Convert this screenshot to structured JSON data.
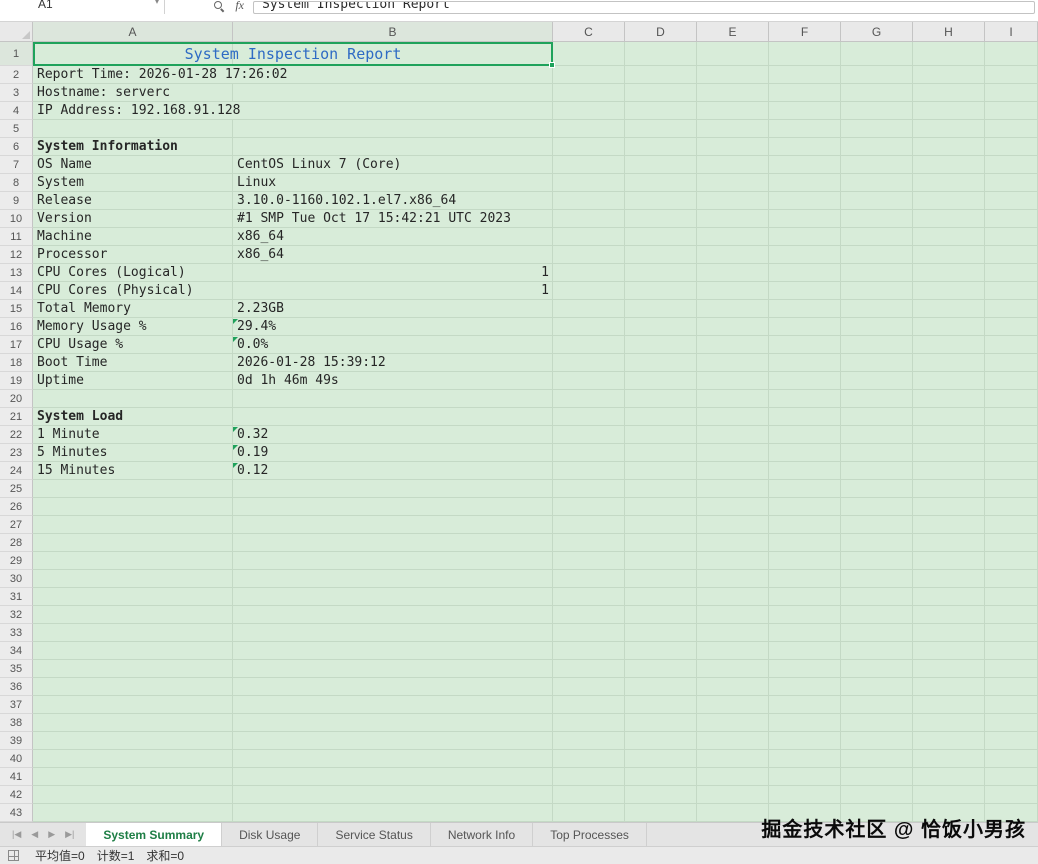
{
  "formula_bar": {
    "cell_ref": "A1",
    "fx": "fx",
    "formula": "System Inspection Report"
  },
  "grid": {
    "columns": [
      "A",
      "B",
      "C",
      "D",
      "E",
      "F",
      "G",
      "H",
      "I"
    ],
    "row_count": 43,
    "title": "System Inspection Report",
    "cells": [
      {
        "r": 2,
        "c": 0,
        "t": "Report Time: 2026-01-28 17:26:02"
      },
      {
        "r": 3,
        "c": 0,
        "t": "Hostname: serverc"
      },
      {
        "r": 4,
        "c": 0,
        "t": "IP Address: 192.168.91.128"
      },
      {
        "r": 6,
        "c": 0,
        "t": "System Information",
        "bold": true
      },
      {
        "r": 7,
        "c": 0,
        "t": "OS Name"
      },
      {
        "r": 7,
        "c": 1,
        "t": "CentOS Linux 7 (Core)"
      },
      {
        "r": 8,
        "c": 0,
        "t": "System"
      },
      {
        "r": 8,
        "c": 1,
        "t": "Linux"
      },
      {
        "r": 9,
        "c": 0,
        "t": "Release"
      },
      {
        "r": 9,
        "c": 1,
        "t": "3.10.0-1160.102.1.el7.x86_64"
      },
      {
        "r": 10,
        "c": 0,
        "t": "Version"
      },
      {
        "r": 10,
        "c": 1,
        "t": "#1 SMP Tue Oct 17 15:42:21 UTC 2023"
      },
      {
        "r": 11,
        "c": 0,
        "t": "Machine"
      },
      {
        "r": 11,
        "c": 1,
        "t": "x86_64"
      },
      {
        "r": 12,
        "c": 0,
        "t": "Processor"
      },
      {
        "r": 12,
        "c": 1,
        "t": "x86_64"
      },
      {
        "r": 13,
        "c": 0,
        "t": "CPU Cores (Logical)"
      },
      {
        "r": 13,
        "c": 1,
        "t": "1",
        "align": "right"
      },
      {
        "r": 14,
        "c": 0,
        "t": "CPU Cores (Physical)"
      },
      {
        "r": 14,
        "c": 1,
        "t": "1",
        "align": "right"
      },
      {
        "r": 15,
        "c": 0,
        "t": "Total Memory"
      },
      {
        "r": 15,
        "c": 1,
        "t": "2.23GB"
      },
      {
        "r": 16,
        "c": 0,
        "t": "Memory Usage %"
      },
      {
        "r": 16,
        "c": 1,
        "t": "29.4%",
        "flag": true
      },
      {
        "r": 17,
        "c": 0,
        "t": "CPU Usage %"
      },
      {
        "r": 17,
        "c": 1,
        "t": "0.0%",
        "flag": true
      },
      {
        "r": 18,
        "c": 0,
        "t": "Boot Time"
      },
      {
        "r": 18,
        "c": 1,
        "t": "2026-01-28 15:39:12"
      },
      {
        "r": 19,
        "c": 0,
        "t": "Uptime"
      },
      {
        "r": 19,
        "c": 1,
        "t": "0d 1h 46m 49s"
      },
      {
        "r": 21,
        "c": 0,
        "t": "System Load",
        "bold": true
      },
      {
        "r": 22,
        "c": 0,
        "t": "1 Minute"
      },
      {
        "r": 22,
        "c": 1,
        "t": "0.32",
        "flag": true
      },
      {
        "r": 23,
        "c": 0,
        "t": "5 Minutes"
      },
      {
        "r": 23,
        "c": 1,
        "t": "0.19",
        "flag": true
      },
      {
        "r": 24,
        "c": 0,
        "t": "15 Minutes"
      },
      {
        "r": 24,
        "c": 1,
        "t": "0.12",
        "flag": true
      }
    ]
  },
  "sheet_tabs": {
    "nav_icons": [
      "first-sheet",
      "previous-sheet",
      "next-sheet",
      "last-sheet"
    ],
    "tabs": [
      {
        "label": "System Summary",
        "active": true
      },
      {
        "label": "Disk Usage",
        "active": false
      },
      {
        "label": "Service Status",
        "active": false
      },
      {
        "label": "Network Info",
        "active": false
      },
      {
        "label": "Top Processes",
        "active": false
      }
    ]
  },
  "status_bar": {
    "metrics": [
      "平均值=0",
      "计数=1",
      "求和=0"
    ]
  },
  "watermark": "掘金技术社区 @ 恰饭小男孩",
  "colors": {
    "cell_bg": "#d8ecd9",
    "gridline": "#c4d9c5",
    "selection_green": "#1fa25b",
    "title_blue": "#2e6bc4",
    "active_tab_green": "#1e7e45"
  }
}
